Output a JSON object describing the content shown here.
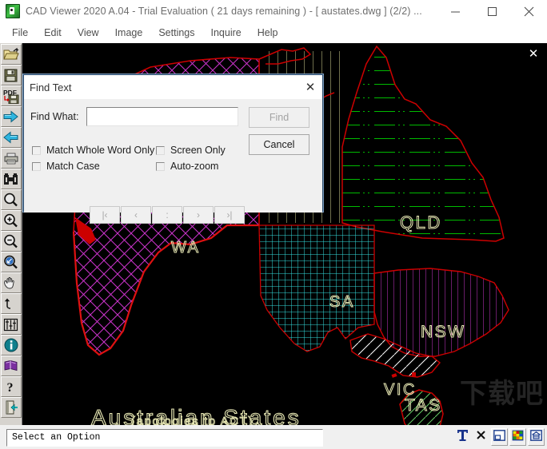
{
  "window": {
    "title": "CAD Viewer 2020 A.04 - Trial Evaluation ( 21 days remaining )  -  [ austates.dwg ] (2/2) ...",
    "app_icon": "cad-viewer-icon",
    "minimize": "─",
    "maximize": "□",
    "close": "✕"
  },
  "menubar": {
    "items": [
      {
        "label": "File"
      },
      {
        "label": "Edit"
      },
      {
        "label": "View"
      },
      {
        "label": "Image"
      },
      {
        "label": "Settings"
      },
      {
        "label": "Inquire"
      },
      {
        "label": "Help"
      }
    ]
  },
  "toolbar": {
    "items": [
      {
        "name": "open-file-icon",
        "tip": "Open"
      },
      {
        "name": "save-icon",
        "tip": "Save"
      },
      {
        "name": "save-pdf-icon",
        "tip": "Save as PDF"
      },
      {
        "name": "next-arrow-icon",
        "tip": "Next"
      },
      {
        "name": "previous-arrow-icon",
        "tip": "Previous"
      },
      {
        "name": "print-icon",
        "tip": "Print"
      },
      {
        "name": "binoculars-icon",
        "tip": "Find Text"
      },
      {
        "name": "zoom-window-icon",
        "tip": "Zoom Window"
      },
      {
        "name": "zoom-in-icon",
        "tip": "Zoom In"
      },
      {
        "name": "zoom-out-icon",
        "tip": "Zoom Out"
      },
      {
        "name": "zoom-extents-icon",
        "tip": "Zoom Extents"
      },
      {
        "name": "pan-hand-icon",
        "tip": "Pan"
      },
      {
        "name": "undo-arrow-icon",
        "tip": "Undo"
      },
      {
        "name": "layers-icon",
        "tip": "Layers"
      },
      {
        "name": "info-icon",
        "tip": "Info"
      },
      {
        "name": "help-book-icon",
        "tip": "Manual"
      },
      {
        "name": "help-question-icon",
        "tip": "Help"
      },
      {
        "name": "exit-door-icon",
        "tip": "Exit"
      }
    ]
  },
  "canvas": {
    "close_glyph": "✕",
    "watermark": "下载吧",
    "title": "Australian  States",
    "subtitle": "(apologies to ACT)",
    "label_color": "#e8e8b4",
    "outline_color": "#cc0000",
    "background": "#000000",
    "states": [
      {
        "code": "NT",
        "label": "",
        "hatch": "vertical",
        "hatch_color": "#e8e8a0"
      },
      {
        "code": "QLD",
        "label": "QLD",
        "hatch": "dash-dot",
        "hatch_color": "#00bb00"
      },
      {
        "code": "WA",
        "label": "WA",
        "hatch": "diagonal-cross",
        "hatch_color": "#cc33cc"
      },
      {
        "code": "SA",
        "label": "SA",
        "hatch": "grid",
        "hatch_color": "#33dddd"
      },
      {
        "code": "NSW",
        "label": "NSW",
        "hatch": "vertical",
        "hatch_color": "#bb33bb"
      },
      {
        "code": "VIC",
        "label": "VIC",
        "hatch": "diagonal",
        "hatch_color": "#ffffff"
      },
      {
        "code": "TAS",
        "label": "TAS",
        "hatch": "diagonal",
        "hatch_color": "#66cc66"
      }
    ]
  },
  "find_dialog": {
    "title": "Find Text",
    "close_glyph": "✕",
    "find_what_label": "Find What:",
    "find_what_value": "",
    "find_what_placeholder": "",
    "buttons": {
      "find": "Find",
      "cancel": "Cancel"
    },
    "checkboxes": [
      {
        "label": "Match Whole Word Only",
        "checked": false
      },
      {
        "label": "Match Case",
        "checked": false
      },
      {
        "label": "Screen Only",
        "checked": false
      },
      {
        "label": "Auto-zoom",
        "checked": false
      }
    ],
    "nav_buttons": [
      {
        "label": "|‹",
        "name": "nav-first"
      },
      {
        "label": "‹",
        "name": "nav-previous"
      },
      {
        "label": ":",
        "name": "nav-current"
      },
      {
        "label": "›",
        "name": "nav-next"
      },
      {
        "label": "›|",
        "name": "nav-last"
      }
    ]
  },
  "statusbar": {
    "message": "Select an Option",
    "icons": [
      {
        "name": "text-tool-icon",
        "glyph": "T"
      },
      {
        "name": "delete-tool-icon",
        "glyph": "✕"
      },
      {
        "name": "layout-view-icon",
        "glyph": ""
      },
      {
        "name": "color-palette-icon",
        "glyph": ""
      },
      {
        "name": "model-view-icon",
        "glyph": ""
      }
    ]
  }
}
